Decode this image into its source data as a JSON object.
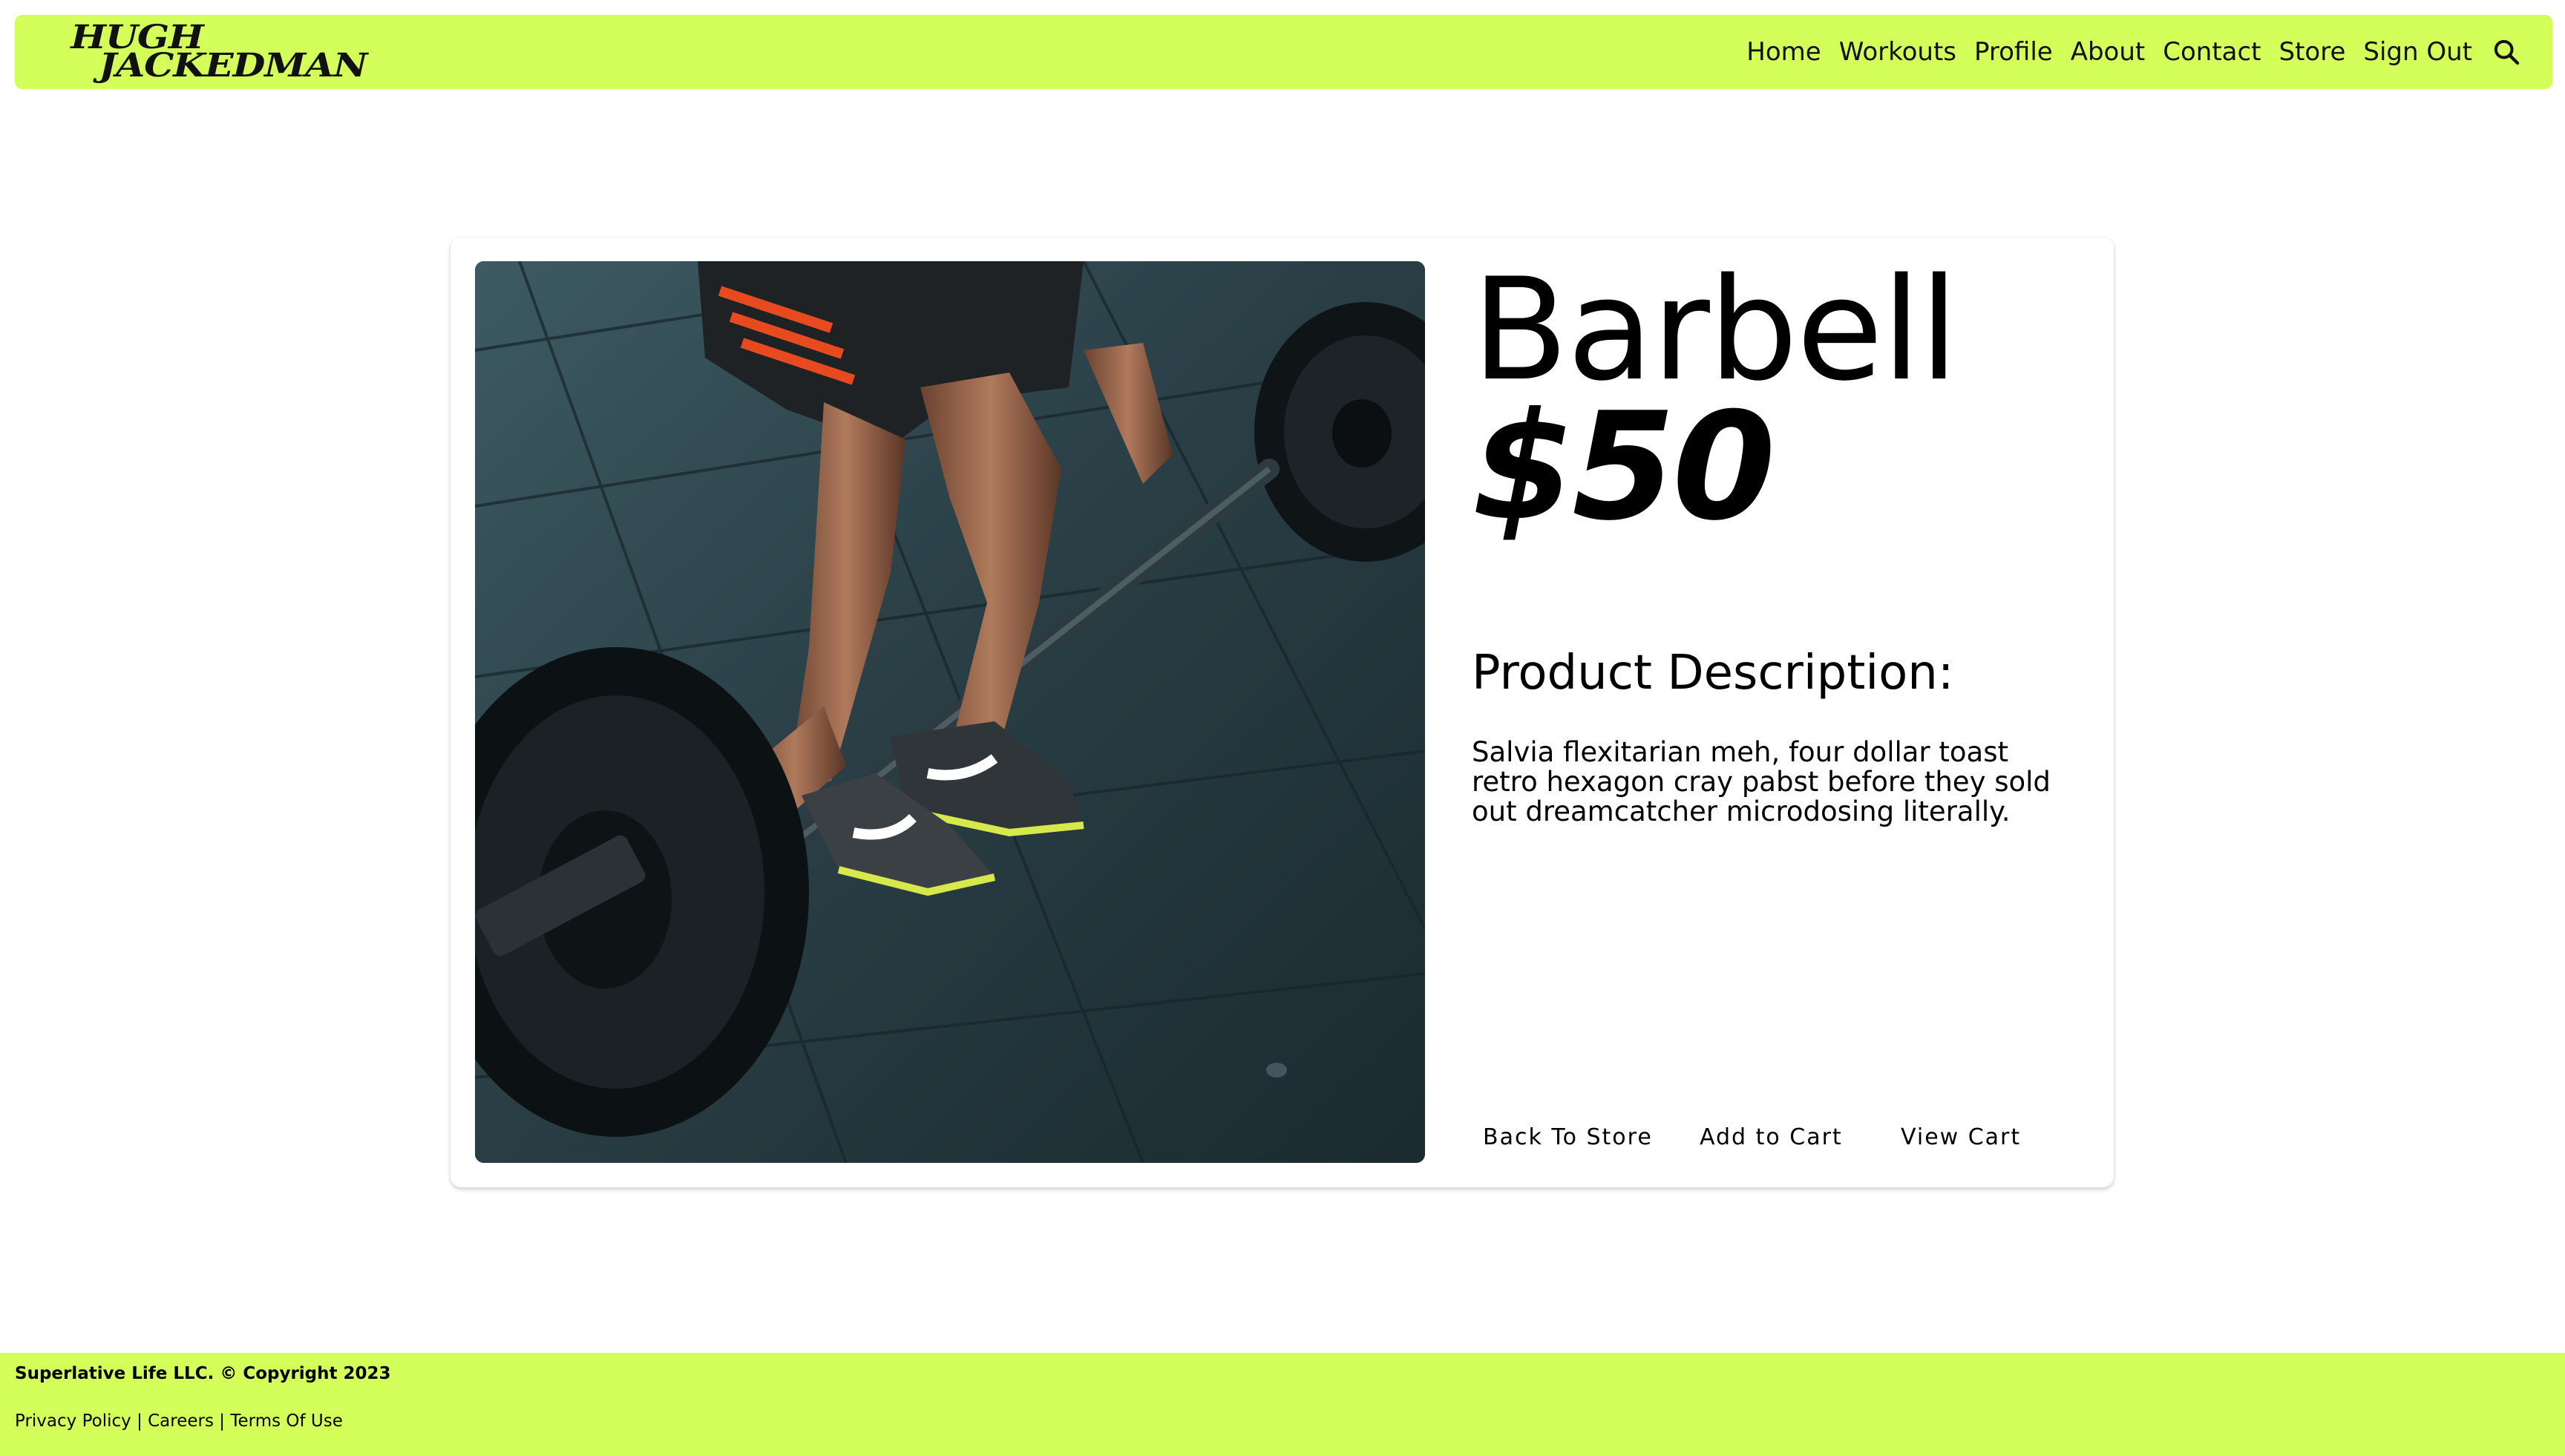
{
  "header": {
    "logo_line1": "HUGH",
    "logo_line2": "JACKEDMAN",
    "nav": [
      "Home",
      "Workouts",
      "Profile",
      "About",
      "Contact",
      "Store",
      "Sign Out"
    ],
    "search_icon": "search-icon"
  },
  "product": {
    "name": "Barbell",
    "price": "$50",
    "description_heading": "Product Description:",
    "description": "Salvia flexitarian meh, four dollar toast retro hexagon cray pabst before they sold out dreamcatcher microdosing literally.",
    "image": "barbell-deadlift-photo"
  },
  "actions": {
    "back": "Back To Store",
    "add": "Add to Cart",
    "view": "View Cart"
  },
  "footer": {
    "copyright": "Superlative Life LLC. © Copyright 2023",
    "links": [
      "Privacy Policy",
      "Careers",
      "Terms Of Use"
    ],
    "separator": "|"
  },
  "colors": {
    "accent": "#d4ff5a",
    "text": "#000000",
    "background": "#ffffff"
  }
}
